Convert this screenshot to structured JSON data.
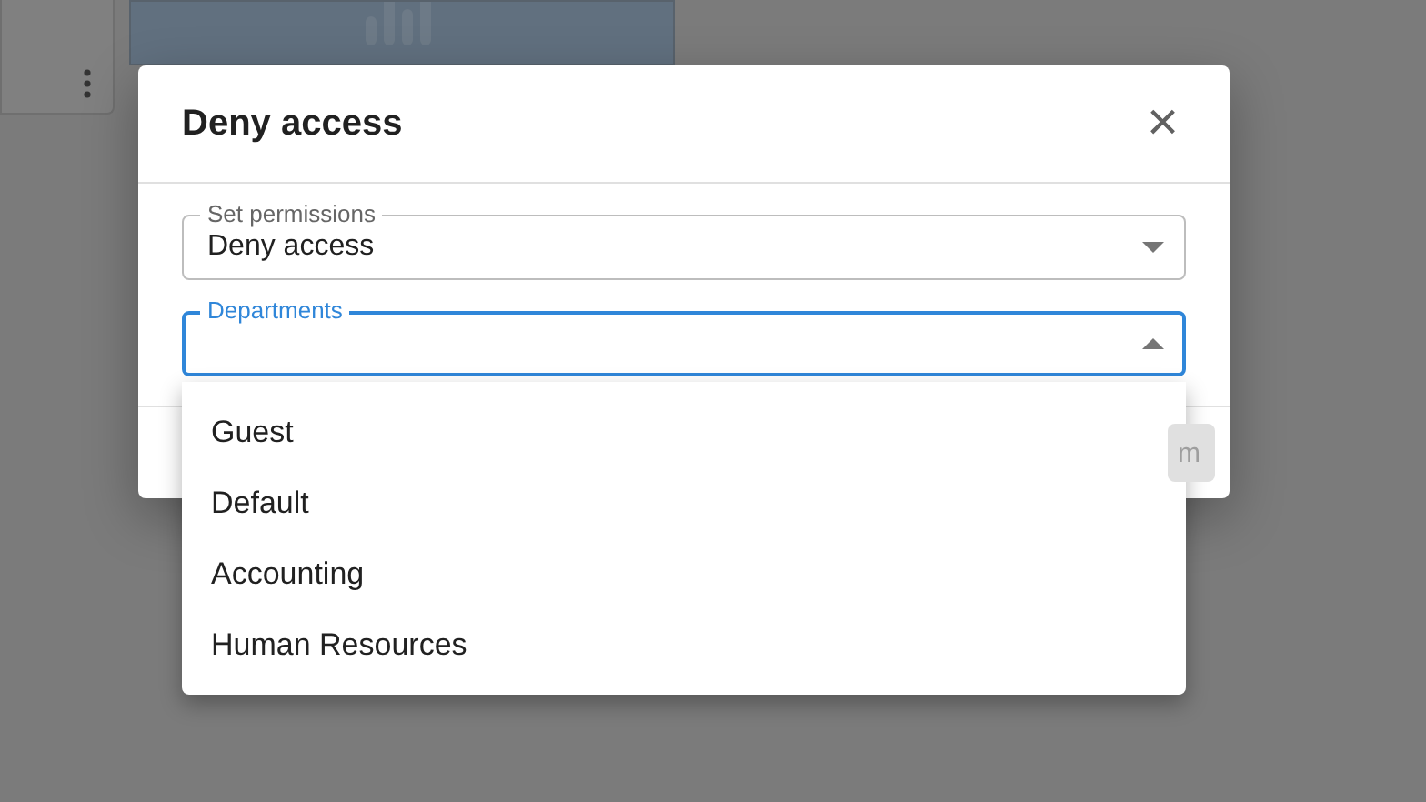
{
  "dialog": {
    "title": "Deny access",
    "close": "×",
    "fields": [
      {
        "label": "Set permissions",
        "value": "Deny access",
        "focused": false,
        "expanded": false
      },
      {
        "label": "Departments",
        "focused": true,
        "expanded": true
      }
    ],
    "footer_button": {
      "label": "m",
      "disabled": true
    }
  },
  "menu": {
    "options": [
      {
        "label": "Guest",
        "selected": false
      },
      {
        "label": "Default",
        "selected": false
      },
      {
        "label": "Accounting",
        "selected": false
      },
      {
        "label": "Human Resources",
        "selected": false
      }
    ]
  }
}
